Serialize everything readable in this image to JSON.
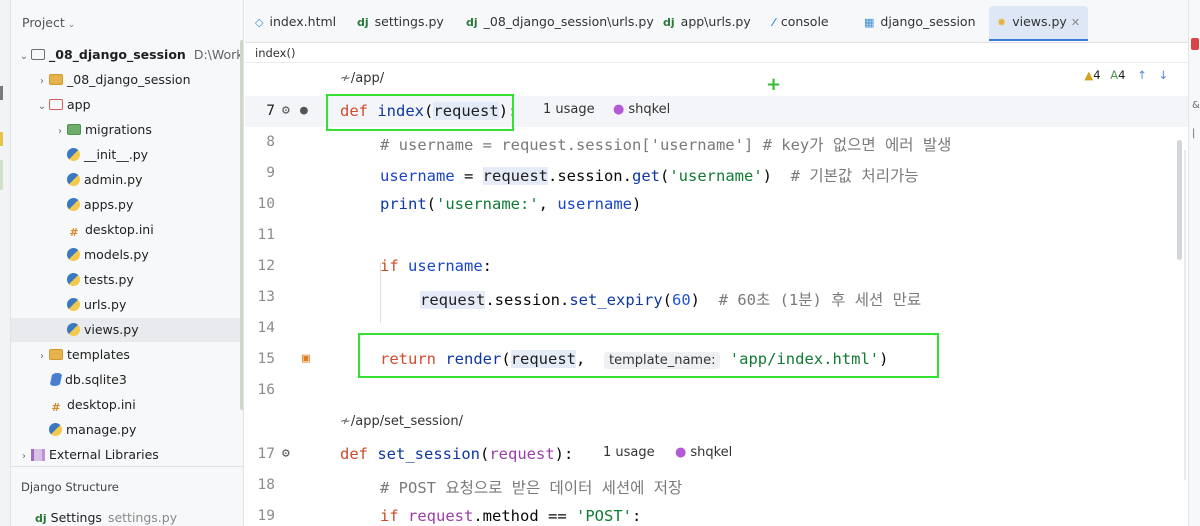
{
  "project_panel": {
    "title": "Project",
    "tree": [
      {
        "label": "_08_django_session",
        "path": "D:\\Workspac",
        "kind": "root"
      },
      {
        "label": "_08_django_session",
        "kind": "folder"
      },
      {
        "label": "app",
        "kind": "folder"
      },
      {
        "label": "migrations",
        "kind": "folder"
      },
      {
        "label": "__init__.py",
        "kind": "py"
      },
      {
        "label": "admin.py",
        "kind": "py"
      },
      {
        "label": "apps.py",
        "kind": "py"
      },
      {
        "label": "desktop.ini",
        "kind": "ini"
      },
      {
        "label": "models.py",
        "kind": "py"
      },
      {
        "label": "tests.py",
        "kind": "py"
      },
      {
        "label": "urls.py",
        "kind": "py"
      },
      {
        "label": "views.py",
        "kind": "py"
      },
      {
        "label": "templates",
        "kind": "folder"
      },
      {
        "label": "db.sqlite3",
        "kind": "db"
      },
      {
        "label": "desktop.ini",
        "kind": "ini"
      },
      {
        "label": "manage.py",
        "kind": "py"
      },
      {
        "label": "External Libraries",
        "kind": "lib"
      }
    ],
    "django_structure": "Django Structure",
    "settings_label": "Settings",
    "settings_file": "settings.py"
  },
  "tabs": [
    {
      "label": "index.html",
      "icon": "html-icon"
    },
    {
      "label": "settings.py",
      "icon": "django-icon"
    },
    {
      "label": "_08_django_session\\urls.py",
      "icon": "django-icon"
    },
    {
      "label": "app\\urls.py",
      "icon": "django-icon"
    },
    {
      "label": "console",
      "icon": "console-icon"
    },
    {
      "label": "django_session",
      "icon": "table-icon"
    },
    {
      "label": "views.py",
      "icon": "python-icon",
      "active": true
    }
  ],
  "breadcrumb": "index()",
  "inspections": {
    "warnings": "4",
    "typos": "4"
  },
  "editor": {
    "route1": "/app/",
    "route2": "/app/set_session/",
    "usage1": "1 usage",
    "author1": "shqkel",
    "usage2": "1 usage",
    "author2": "shqkel",
    "lineno": [
      "7",
      "8",
      "9",
      "10",
      "11",
      "12",
      "13",
      "14",
      "15",
      "16",
      "17",
      "18",
      "19"
    ],
    "hint_template_name": "template_name:",
    "comment_l8": "# username = request.session['username'] # key가 없으면 에러 발생",
    "comment_l9": "# 기본값 처리가능",
    "comment_l13": "# 60초 (1분) 후 세션 만료",
    "comment_l18": "# POST 요청으로 받은 데이터 세션에 저장"
  }
}
